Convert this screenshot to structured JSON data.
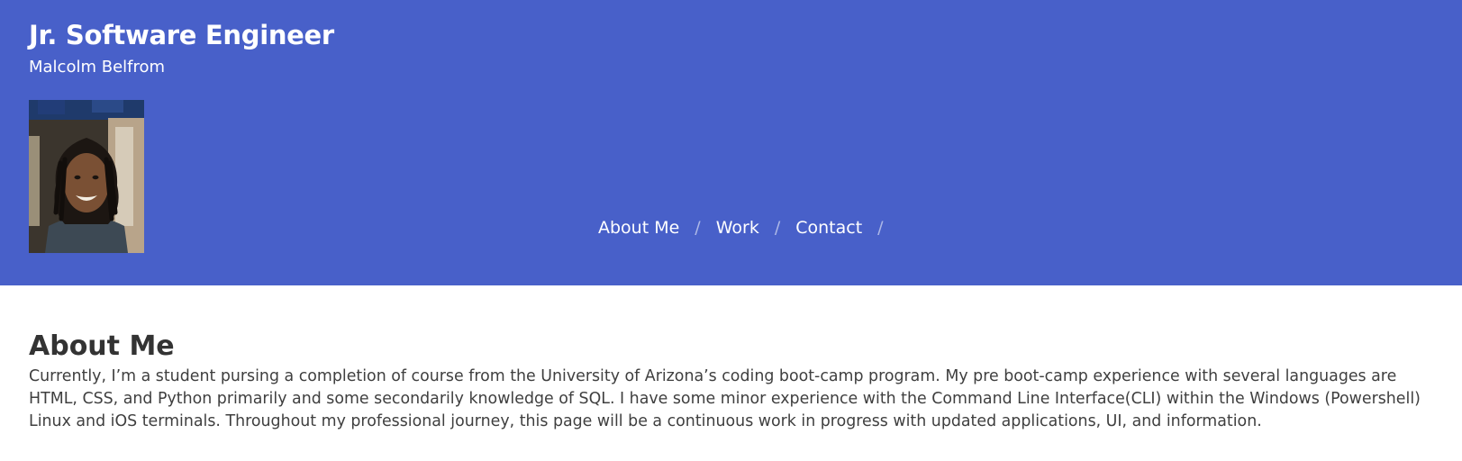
{
  "header": {
    "title": "Jr. Software Engineer",
    "subtitle": "Malcolm Belfrom",
    "background_color": "#4860c9",
    "avatar_icon": "profile-photo"
  },
  "nav": {
    "items": [
      {
        "label": "About Me"
      },
      {
        "label": "Work"
      },
      {
        "label": "Contact"
      }
    ],
    "separator": "/"
  },
  "about": {
    "heading": "About Me",
    "body": "Currently, I’m a student pursing a completion of course from the University of Arizona’s coding boot-camp program. My pre boot-camp experience with several languages are HTML, CSS, and Python primarily and some secondarily knowledge of SQL. I have some minor experience with the Command Line Interface(CLI) within the Windows (Powershell) Linux and iOS terminals. Throughout my professional journey, this page will be a continuous work in progress with updated applications, UI, and information."
  }
}
